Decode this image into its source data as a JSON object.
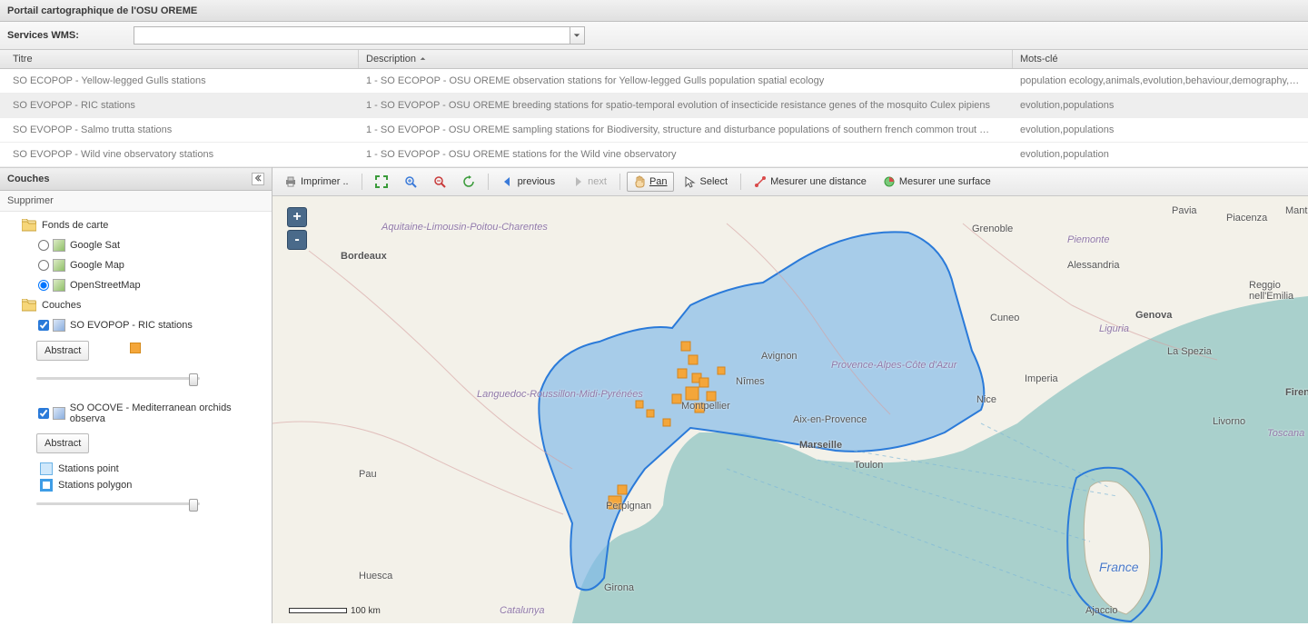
{
  "header": {
    "title": "Portail cartographique de l'OSU OREME"
  },
  "services": {
    "label": "Services WMS:",
    "value": ""
  },
  "grid": {
    "headers": {
      "title": "Titre",
      "desc": "Description",
      "key": "Mots-clé"
    },
    "rows": [
      {
        "title": "SO ECOPOP - Yellow-legged Gulls stations",
        "desc": "1 - SO ECOPOP - OSU OREME observation stations for Yellow-legged Gulls population spatial ecology",
        "key": "population ecology,animals,evolution,behaviour,demography,pathoge",
        "selected": false
      },
      {
        "title": "SO EVOPOP - RIC stations",
        "desc": "1 - SO EVOPOP - OSU OREME breeding stations for spatio-temporal evolution of insecticide resistance genes of the mosquito Culex pipiens",
        "key": "evolution,populations",
        "selected": true
      },
      {
        "title": "SO EVOPOP - Salmo trutta stations",
        "desc": "1 - SO EVOPOP - OSU OREME sampling stations for Biodiversity, structure and disturbance populations of southern french common trout …",
        "key": "evolution,populations",
        "selected": false
      },
      {
        "title": "SO EVOPOP - Wild vine observatory stations",
        "desc": "1 - SO EVOPOP - OSU OREME stations for the Wild vine observatory",
        "key": "evolution,population",
        "selected": false
      }
    ]
  },
  "layers_panel": {
    "title": "Couches",
    "suppr": "Supprimer",
    "folders": {
      "basemaps": "Fonds de carte",
      "layers": "Couches"
    },
    "basemaps": [
      {
        "label": "Google Sat",
        "selected": false
      },
      {
        "label": "Google Map",
        "selected": false
      },
      {
        "label": "OpenStreetMap",
        "selected": true
      }
    ],
    "overlays": [
      {
        "label": "SO EVOPOP - RIC stations",
        "checked": true,
        "abstract": "Abstract",
        "legend": [
          {
            "type": "swatch"
          }
        ]
      },
      {
        "label": "SO OCOVE - Mediterranean orchids observa",
        "checked": true,
        "abstract": "Abstract",
        "legend": [
          {
            "type": "pt",
            "label": "Stations point"
          },
          {
            "type": "poly",
            "label": "Stations polygon"
          }
        ]
      }
    ]
  },
  "toolbar": {
    "print": "Imprimer ..",
    "previous": "previous",
    "next": "next",
    "pan": "Pan",
    "select": "Select",
    "measure_dist": "Mesurer une distance",
    "measure_area": "Mesurer une surface"
  },
  "map": {
    "zoom_in": "+",
    "zoom_out": "-",
    "scale_label": "100 km",
    "labels": {
      "france": "France",
      "aquitaine": "Aquitaine-Limousin-Poitou-Charentes",
      "languedoc": "Languedoc-Roussillon-Midi-Pyrénées",
      "paca": "Provence-Alpes-Côte d'Azur",
      "piemonte": "Piemonte",
      "liguria": "Liguria",
      "toscana": "Toscana",
      "catalunya": "Catalunya",
      "bordeaux": "Bordeaux",
      "montpellier": "Montpellier",
      "nimes": "Nîmes",
      "avignon": "Avignon",
      "aix": "Aix-en-Provence",
      "marseille": "Marseille",
      "toulon": "Toulon",
      "nice": "Nice",
      "genova": "Genova",
      "pau": "Pau",
      "huesca": "Huesca",
      "girona": "Girona",
      "perpignan": "Perpignan",
      "grenoble": "Grenoble",
      "alessandria": "Alessandria",
      "cuneo": "Cuneo",
      "pavia": "Pavia",
      "piacenza": "Piacenza",
      "mantova": "Mantova",
      "reggio": "Reggio nell'Emilia",
      "firenze": "Firenze",
      "laspezia": "La Spezia",
      "livorno": "Livorno",
      "imperia": "Imperia",
      "ajaccio": "Ajaccio"
    }
  }
}
